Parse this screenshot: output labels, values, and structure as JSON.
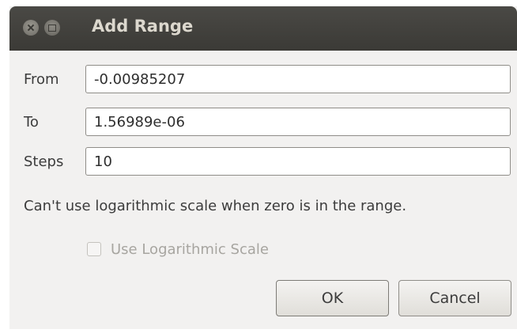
{
  "window": {
    "title": "Add Range",
    "close_icon": "close-icon",
    "maximize_icon": "maximize-icon"
  },
  "form": {
    "from": {
      "label": "From",
      "value": "-0.00985207"
    },
    "to": {
      "label": "To",
      "value": "1.56989e-06"
    },
    "steps": {
      "label": "Steps",
      "value": "10"
    }
  },
  "message": "Can't use logarithmic scale when zero is in the range.",
  "log_scale": {
    "label": "Use Logarithmic Scale",
    "checked": false,
    "enabled": false
  },
  "buttons": {
    "ok": "OK",
    "cancel": "Cancel"
  }
}
